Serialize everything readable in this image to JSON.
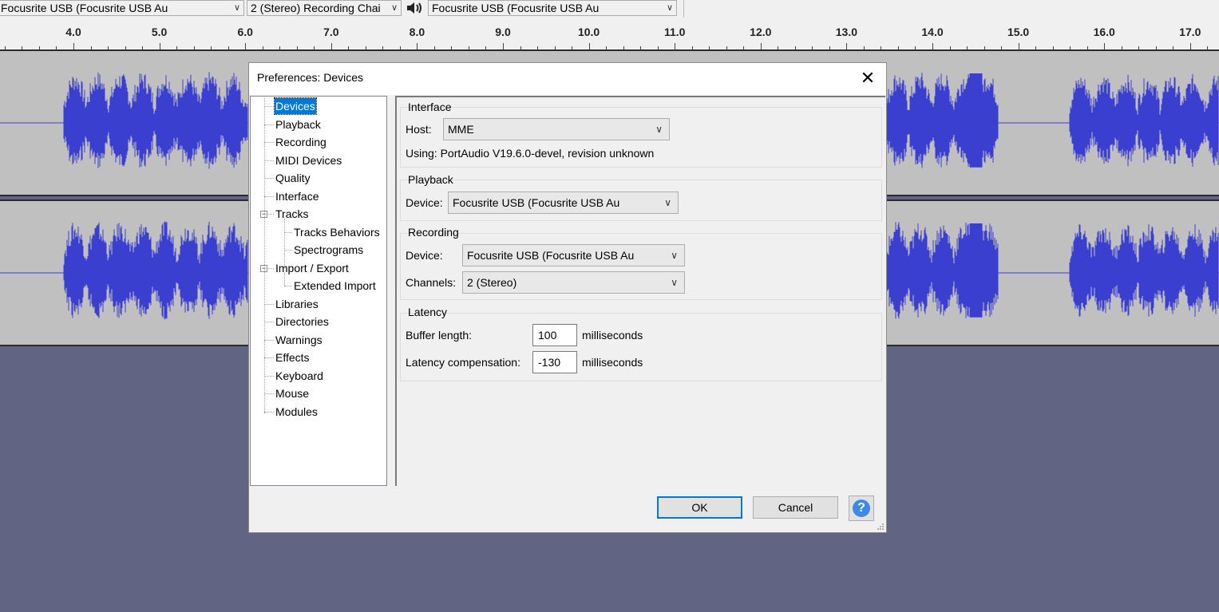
{
  "toolbar": {
    "recording_device": "Focusrite USB (Focusrite USB Au",
    "recording_channels": "2 (Stereo) Recording Chai",
    "playback_device": "Focusrite USB (Focusrite USB Au",
    "speaker_icon": "speaker-icon"
  },
  "ruler": {
    "labels": [
      "4.0",
      "5.0",
      "6.0",
      "7.0",
      "8.0",
      "9.0",
      "10.0",
      "11.0",
      "12.0",
      "13.0",
      "14.0",
      "15.0",
      "16.0",
      "17.0"
    ]
  },
  "colors": {
    "background": "#626483",
    "track": "#c0c0c0",
    "waveform": "#3b3fd0",
    "selection": "#0078d7"
  },
  "dialog": {
    "title": "Preferences: Devices",
    "close_icon": "close-icon",
    "tree": [
      {
        "label": "Devices",
        "selected": true
      },
      {
        "label": "Playback"
      },
      {
        "label": "Recording"
      },
      {
        "label": "MIDI Devices"
      },
      {
        "label": "Quality"
      },
      {
        "label": "Interface"
      },
      {
        "label": "Tracks",
        "expander": "−"
      },
      {
        "label": "Tracks Behaviors",
        "child": true
      },
      {
        "label": "Spectrograms",
        "child": true
      },
      {
        "label": "Import / Export",
        "expander": "−"
      },
      {
        "label": "Extended Import",
        "child": true
      },
      {
        "label": "Libraries"
      },
      {
        "label": "Directories"
      },
      {
        "label": "Warnings"
      },
      {
        "label": "Effects"
      },
      {
        "label": "Keyboard"
      },
      {
        "label": "Mouse"
      },
      {
        "label": "Modules"
      }
    ],
    "interface": {
      "title": "Interface",
      "host_label": "Host:",
      "host_value": "MME",
      "using_text": "Using: PortAudio V19.6.0-devel, revision unknown"
    },
    "playback": {
      "title": "Playback",
      "device_label": "Device:",
      "device_value": "Focusrite USB (Focusrite USB Au"
    },
    "recording": {
      "title": "Recording",
      "device_label": "Device:",
      "device_value": "Focusrite USB (Focusrite USB Au",
      "channels_label": "Channels:",
      "channels_value": "2 (Stereo)"
    },
    "latency": {
      "title": "Latency",
      "buffer_label": "Buffer length:",
      "buffer_value": "100",
      "buffer_unit": "milliseconds",
      "compensation_label": "Latency compensation:",
      "compensation_value": "-130",
      "compensation_unit": "milliseconds"
    },
    "buttons": {
      "ok": "OK",
      "cancel": "Cancel",
      "help": "?"
    }
  }
}
